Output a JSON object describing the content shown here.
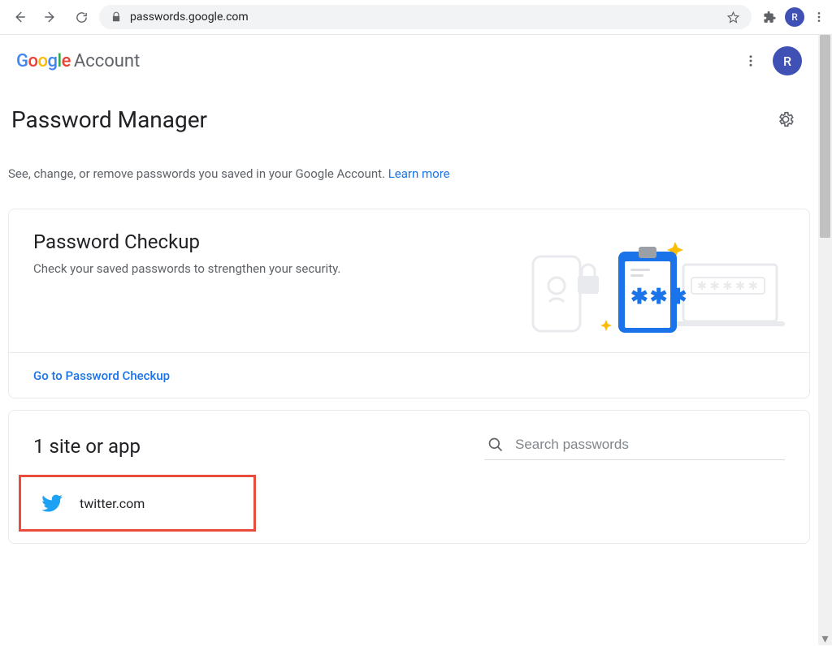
{
  "browser": {
    "url": "passwords.google.com",
    "avatar_initial": "R"
  },
  "header": {
    "logo_text": "Google",
    "account_label": "Account",
    "avatar_initial": "R"
  },
  "page": {
    "title": "Password Manager",
    "subtitle": "See, change, or remove passwords you saved in your Google Account. ",
    "learn_more": "Learn more"
  },
  "checkup": {
    "title": "Password Checkup",
    "description": "Check your saved passwords to strengthen your security.",
    "cta": "Go to Password Checkup"
  },
  "sites": {
    "count_label": "1 site or app",
    "search_placeholder": "Search passwords",
    "items": [
      {
        "name": "twitter.com",
        "icon": "twitter-icon"
      }
    ]
  }
}
